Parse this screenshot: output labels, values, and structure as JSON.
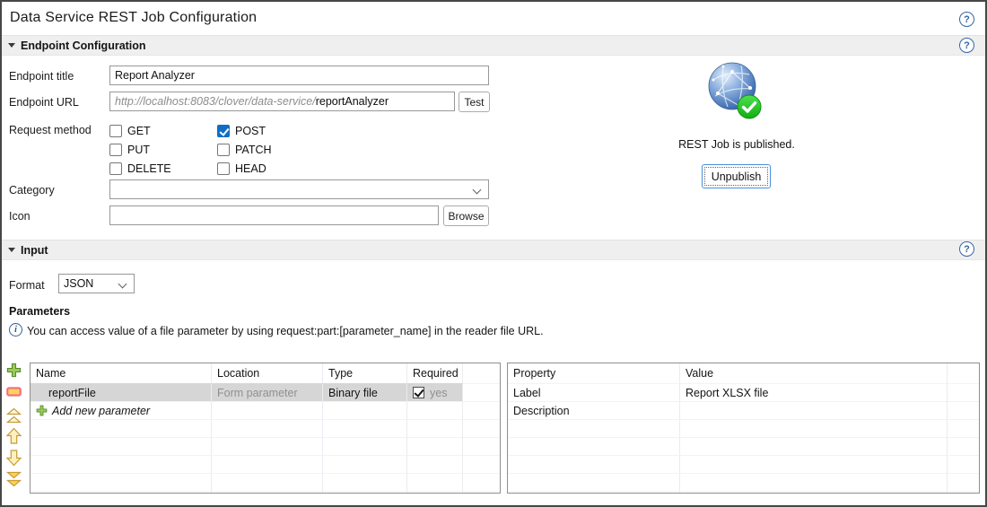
{
  "window": {
    "title": "Data Service REST Job Configuration"
  },
  "icons": {
    "help_glyph": "?",
    "info_glyph": "i"
  },
  "colors": {
    "accent_blue": "#0f6fc5",
    "help_blue": "#3465a4",
    "selected_row": "#d6d6d6",
    "publish_green": "#22bb22"
  },
  "sections": {
    "endpoint_title": "Endpoint Configuration",
    "input_title": "Input"
  },
  "endpoint": {
    "title_label": "Endpoint title",
    "title_value": "Report Analyzer",
    "url_label": "Endpoint URL",
    "url_prefix": "http://localhost:8083/clover/data-service/",
    "url_suffix": "reportAnalyzer",
    "test_button": "Test",
    "method_label": "Request method",
    "methods": [
      {
        "label": "GET",
        "checked": false
      },
      {
        "label": "POST",
        "checked": true
      },
      {
        "label": "PUT",
        "checked": false
      },
      {
        "label": "PATCH",
        "checked": false
      },
      {
        "label": "DELETE",
        "checked": false
      },
      {
        "label": "HEAD",
        "checked": false
      }
    ],
    "category_label": "Category",
    "category_value": "",
    "icon_label": "Icon",
    "icon_value": "",
    "browse_button": "Browse"
  },
  "publish": {
    "status_text": "REST Job is published.",
    "unpublish_button": "Unpublish"
  },
  "input_section": {
    "format_label": "Format",
    "format_value": "JSON"
  },
  "parameters": {
    "heading": "Parameters",
    "info_text": "You can access value of a file parameter by using request:part:[parameter_name] in the reader file URL.",
    "toolbar": [
      "add-parameter",
      "remove-parameter",
      "move-to-top",
      "move-up",
      "move-down",
      "move-to-bottom"
    ],
    "table": {
      "headers": [
        "Name",
        "Location",
        "Type",
        "Required"
      ],
      "row": {
        "name": "reportFile",
        "location": "Form parameter",
        "type": "Binary file",
        "required_checked": true,
        "required_text": "yes"
      },
      "add_row_label": "Add new parameter"
    },
    "properties": {
      "headers": [
        "Property",
        "Value"
      ],
      "rows": [
        {
          "property": "Label",
          "value": "Report XLSX file"
        },
        {
          "property": "Description",
          "value": ""
        }
      ]
    }
  }
}
